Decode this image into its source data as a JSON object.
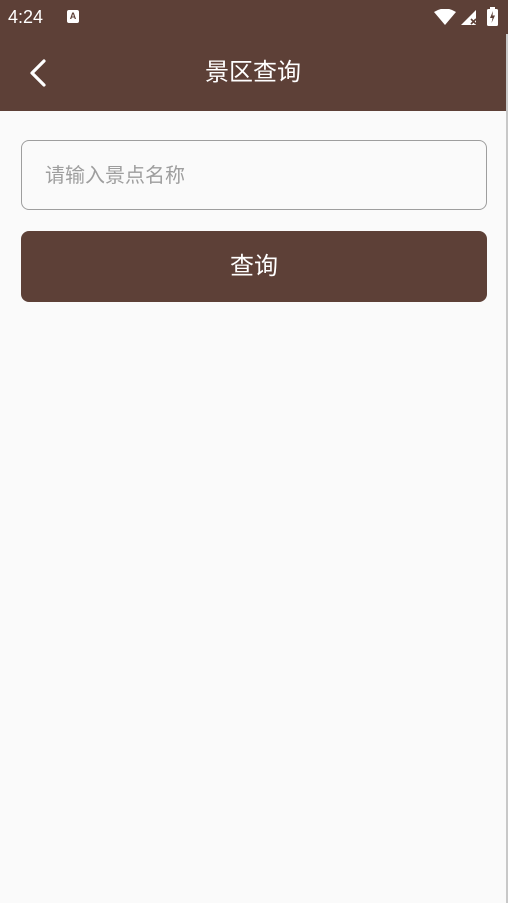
{
  "status_bar": {
    "time": "4:24",
    "notification_icon": "a-icon",
    "wifi_icon": "wifi-icon",
    "signal_icon": "signal-icon",
    "battery_icon": "battery-charging-icon"
  },
  "app_bar": {
    "title": "景区查询",
    "back_icon": "chevron-left-icon",
    "background_color": "#5d4037"
  },
  "search": {
    "placeholder": "请输入景点名称",
    "value": ""
  },
  "query_button": {
    "label": "查询",
    "background_color": "#5d4037"
  }
}
